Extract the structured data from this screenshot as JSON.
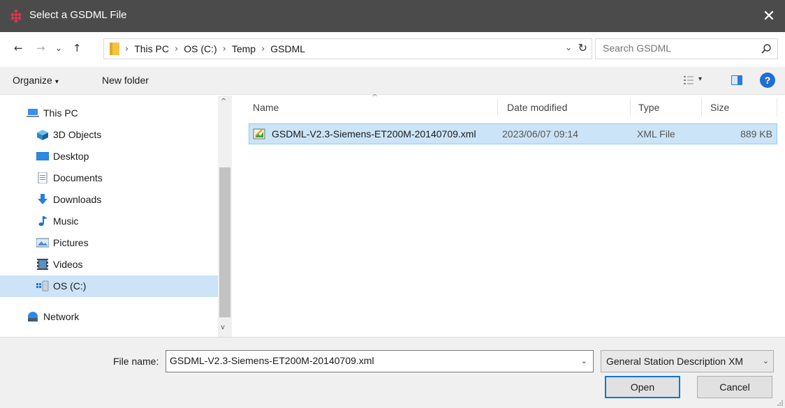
{
  "window": {
    "title": "Select a GSDML File",
    "close_glyph": "✕"
  },
  "nav": {
    "back_glyph": "←",
    "forward_glyph": "→",
    "recent_glyph": "⌄",
    "up_glyph": "↑"
  },
  "address": {
    "crumbs": [
      "This PC",
      "OS (C:)",
      "Temp",
      "GSDML"
    ],
    "separator": "›",
    "dropdown_glyph": "⌄",
    "refresh_glyph": "↻"
  },
  "search": {
    "placeholder": "Search GSDML"
  },
  "toolbar": {
    "organize_label": "Organize",
    "organize_caret": "▾",
    "new_folder_label": "New folder",
    "view_caret": "▾",
    "help_label": "?"
  },
  "sidebar": {
    "items": [
      {
        "label": "This PC",
        "icon": "computer-icon"
      },
      {
        "label": "3D Objects",
        "icon": "cube-icon"
      },
      {
        "label": "Desktop",
        "icon": "desktop-icon"
      },
      {
        "label": "Documents",
        "icon": "documents-icon"
      },
      {
        "label": "Downloads",
        "icon": "downloads-icon"
      },
      {
        "label": "Music",
        "icon": "music-icon"
      },
      {
        "label": "Pictures",
        "icon": "pictures-icon"
      },
      {
        "label": "Videos",
        "icon": "videos-icon"
      },
      {
        "label": "OS (C:)",
        "icon": "drive-icon",
        "selected": true
      },
      {
        "label": "Network",
        "icon": "network-icon"
      }
    ],
    "scroll_up_glyph": "^",
    "scroll_down_glyph": "v"
  },
  "columns": {
    "name": "Name",
    "date": "Date modified",
    "type": "Type",
    "size": "Size",
    "sort_glyph": "^"
  },
  "files": [
    {
      "name": "GSDML-V2.3-Siemens-ET200M-20140709.xml",
      "date": "2023/06/07 09:14",
      "type": "XML File",
      "size": "889 KB",
      "selected": true
    }
  ],
  "footer": {
    "filename_label": "File name:",
    "filename_value": "GSDML-V2.3-Siemens-ET200M-20140709.xml",
    "filetype_value": "General Station Description XM",
    "dropdown_glyph": "⌄",
    "open_label": "Open",
    "cancel_label": "Cancel"
  },
  "colors": {
    "titlebar": "#4b4b4b",
    "selection": "#cce4f7",
    "accent": "#0078d7",
    "app_icon": "#e0344e"
  }
}
